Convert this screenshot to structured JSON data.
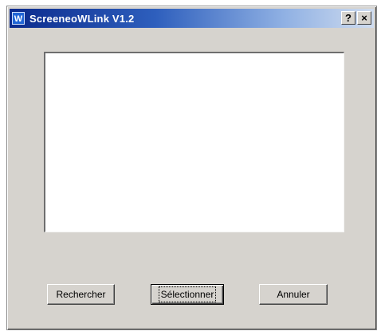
{
  "window": {
    "title": "ScreeneoWLink V1.2",
    "app_icon_letter": "W",
    "help_glyph": "?",
    "close_glyph": "×"
  },
  "buttons": {
    "rechercher": "Rechercher",
    "selectionner": "Sélectionner",
    "annuler": "Annuler"
  },
  "colors": {
    "titlebar_start": "#0b2a8c",
    "titlebar_end": "#cfdcef",
    "dialog_face": "#d6d3ce"
  }
}
